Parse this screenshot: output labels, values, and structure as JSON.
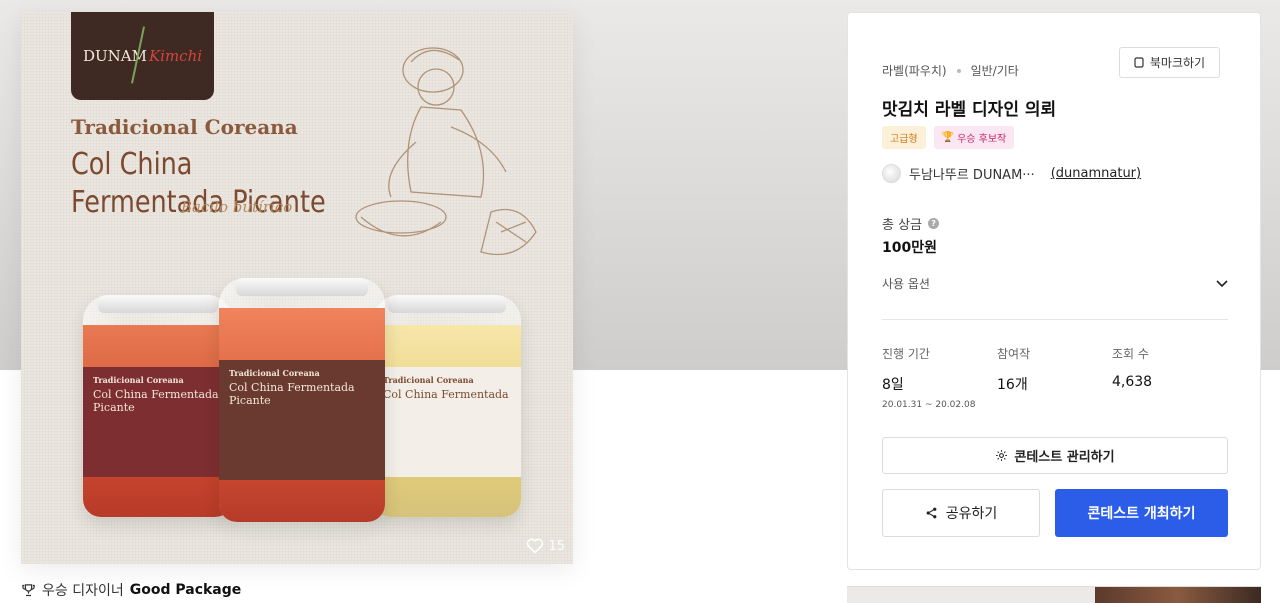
{
  "hero": {
    "logo_text": "DUNAM",
    "logo_accent": "Kimchi",
    "headline_1": "Tradicional Coreana",
    "headline_2": "Col China Fermentada Picante",
    "headline_3": "Bacilo butírico",
    "jars": [
      {
        "label_a": "Tradicional Coreana",
        "label_b": "Col China Fermentada Picante"
      },
      {
        "label_a": "Tradicional Coreana",
        "label_b": "Col China Fermentada Picante"
      },
      {
        "label_a": "Tradicional Coreana",
        "label_b": "Col China Fermentada"
      }
    ],
    "like_count": "15"
  },
  "caption": {
    "prefix": "우승 디자이너",
    "designer": "Good Package"
  },
  "card": {
    "category": "라벨(파우치)",
    "subcategory": "일반/기타",
    "bookmark_label": "북마크하기",
    "title": "맛김치 라벨 디자인 의뢰",
    "badges": {
      "premium": "고급형",
      "winner": "우승 후보작"
    },
    "author_name": "두남나뚜르 DUNAM···",
    "author_handle": "(dunamnatur)",
    "prize_label": "총 상금",
    "prize_value": "100만원",
    "usage_label": "사용 옵션",
    "stats": {
      "period_label": "진행 기간",
      "period_value": "8일",
      "period_range": "20.01.31 ~ 20.02.08",
      "entries_label": "참여작",
      "entries_value": "16개",
      "views_label": "조회 수",
      "views_value": "4,638"
    },
    "manage_button": "콘테스트 관리하기",
    "share_button": "공유하기",
    "host_button": "콘테스트 개최하기"
  },
  "colors": {
    "primary": "#2b5de8",
    "premium_bg": "#fdf0d9",
    "winner_bg": "#fbe7f1"
  }
}
